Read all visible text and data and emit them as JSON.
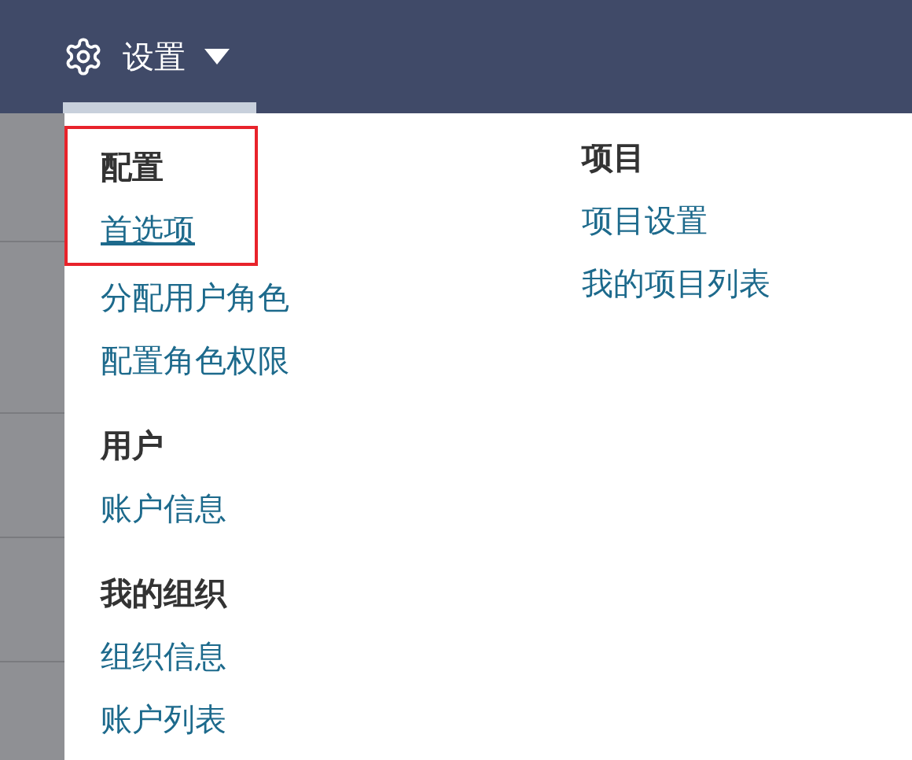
{
  "top_bar": {
    "menu_button": {
      "label": "设置",
      "expanded": true
    }
  },
  "menu": {
    "columns": [
      {
        "sections": [
          {
            "heading": "配置",
            "items": [
              {
                "label": "首选项",
                "highlighted": true
              },
              {
                "label": "分配用户角色",
                "highlighted": false
              },
              {
                "label": "配置角色权限",
                "highlighted": false
              }
            ]
          },
          {
            "heading": "用户",
            "items": [
              {
                "label": "账户信息",
                "highlighted": false
              }
            ]
          },
          {
            "heading": "我的组织",
            "items": [
              {
                "label": "组织信息",
                "highlighted": false
              },
              {
                "label": "账户列表",
                "highlighted": false
              }
            ]
          }
        ]
      },
      {
        "sections": [
          {
            "heading": "项目",
            "items": [
              {
                "label": "项目设置",
                "highlighted": false
              },
              {
                "label": "我的项目列表",
                "highlighted": false
              }
            ]
          }
        ]
      }
    ]
  }
}
